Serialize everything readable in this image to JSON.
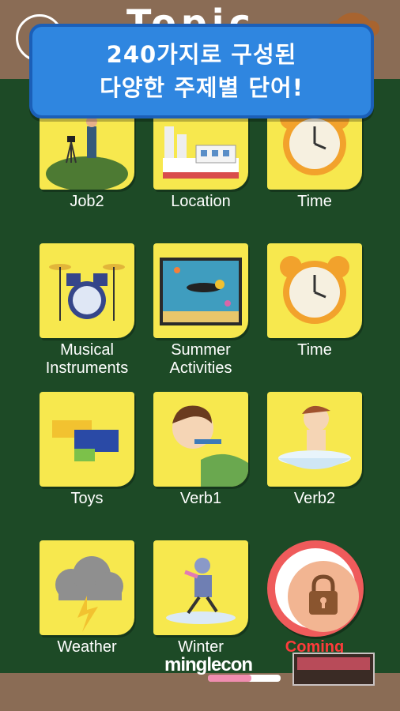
{
  "header": {
    "title_peek": "Topic",
    "back_icon": "back-arrow-icon",
    "mascot_icon": "monkey-icon"
  },
  "banner": {
    "line1": "240가지로 구성된",
    "line2": "다양한 주제별 단어!"
  },
  "topics": [
    {
      "label": "Job2",
      "icon": "photographer-icon"
    },
    {
      "label": "Location",
      "icon": "factory-icon"
    },
    {
      "label": "Time",
      "icon": "alarm-clock-icon"
    },
    {
      "label_line1": "Musical",
      "label_line2": "Instruments",
      "icon": "drum-kit-icon"
    },
    {
      "label_line1": "Summer",
      "label_line2": "Activities",
      "icon": "scuba-diver-icon"
    },
    {
      "label": "Time",
      "icon": "alarm-clock-icon"
    },
    {
      "label": "Toys",
      "icon": "toy-bricks-icon"
    },
    {
      "label": "Verb1",
      "icon": "brushing-teeth-icon"
    },
    {
      "label": "Verb2",
      "icon": "washing-face-icon"
    },
    {
      "label": "Weather",
      "icon": "storm-cloud-icon"
    },
    {
      "label": "Winter",
      "icon": "ice-skater-icon"
    },
    {
      "label": "Coming",
      "icon": "padlock-icon"
    }
  ],
  "footer": {
    "logo": "minglecon",
    "progress": 0.6
  },
  "colors": {
    "board": "#1d4a26",
    "frame": "#8a6c55",
    "tile": "#f7e84e",
    "banner": "#2f86e0",
    "coming": "#ef5b5b"
  }
}
